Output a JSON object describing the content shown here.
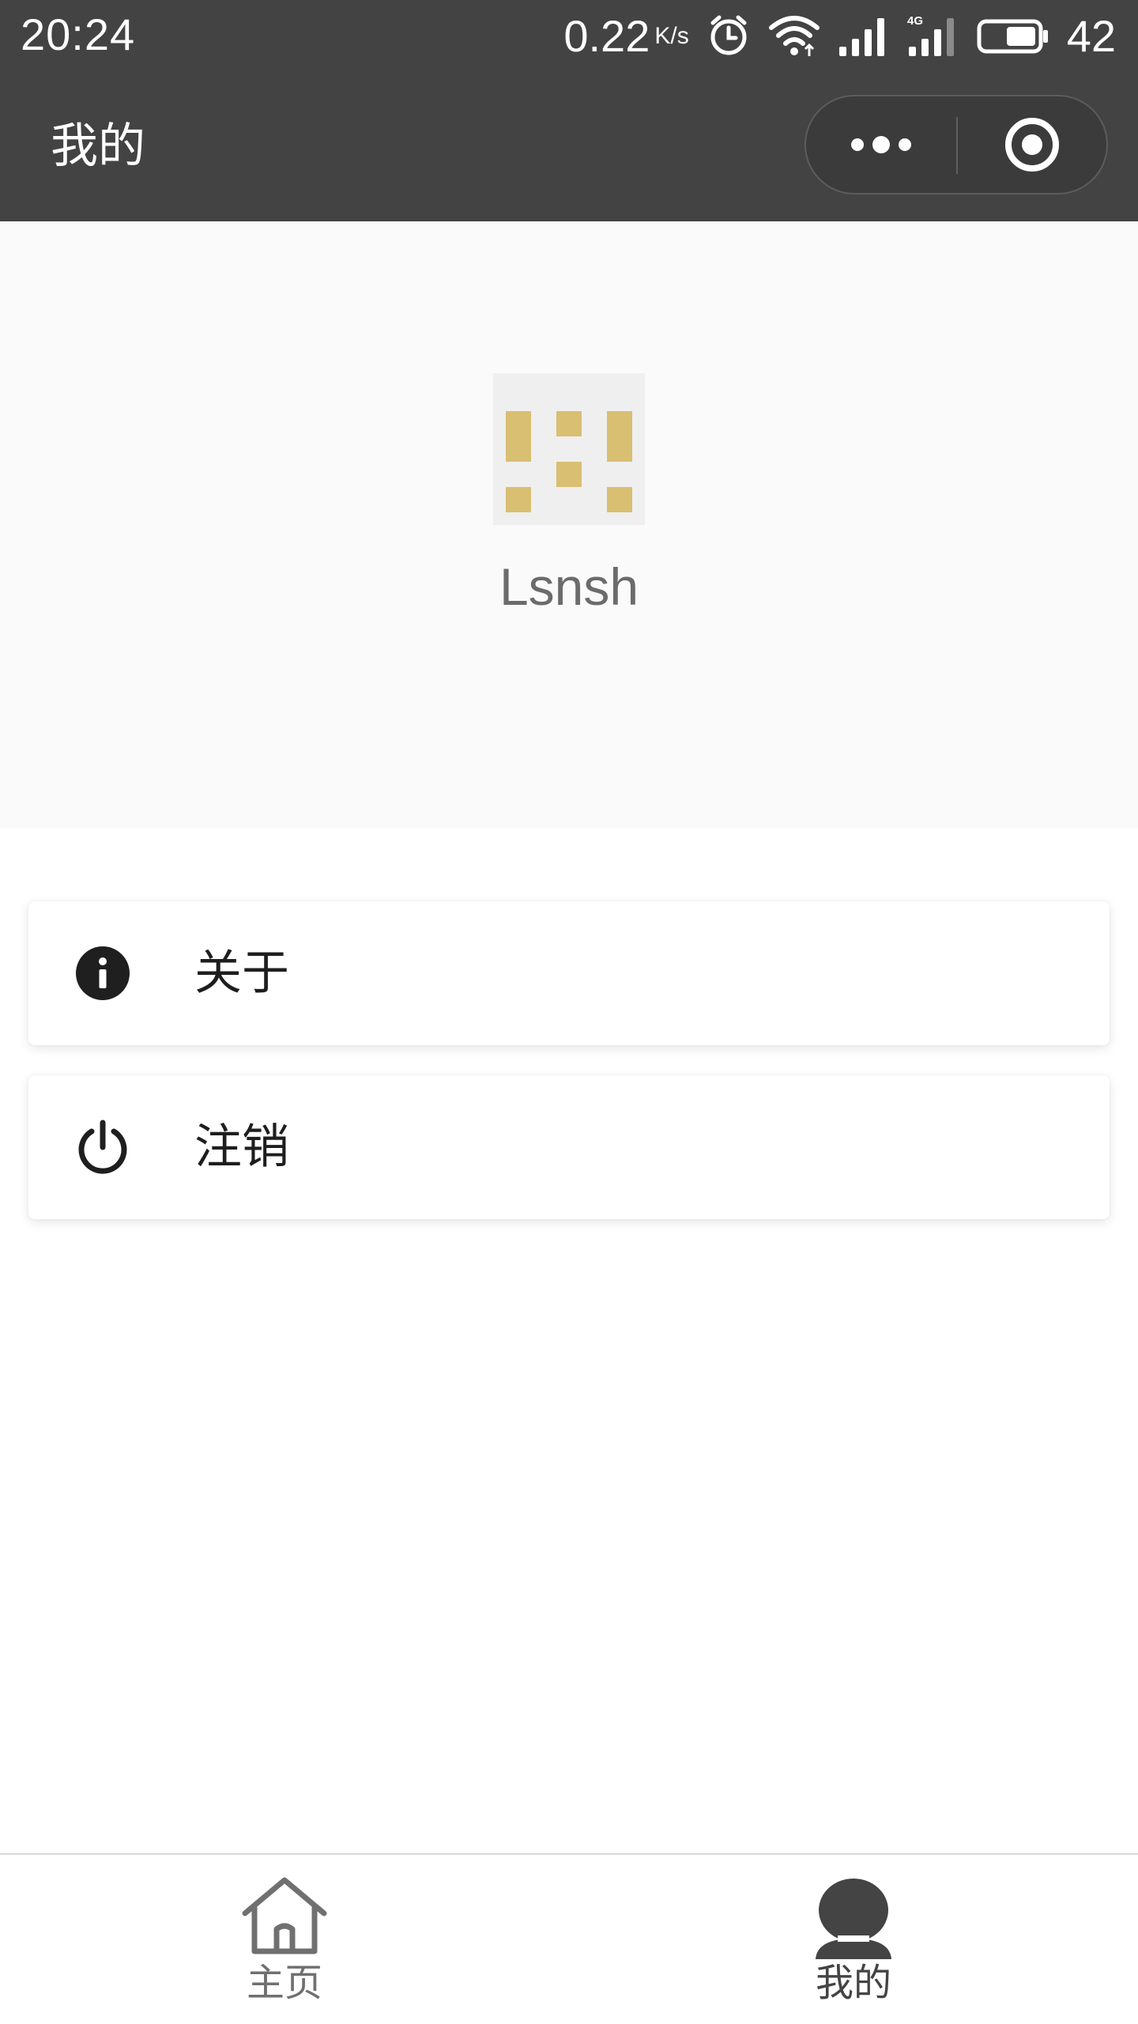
{
  "status_bar": {
    "time": "20:24",
    "net_speed": "0.22",
    "net_speed_unit": "K/s",
    "network_type": "4G",
    "battery": "42",
    "icons": [
      "alarm-icon",
      "wifi-icon",
      "signal-icon",
      "signal-4g-icon",
      "battery-icon"
    ]
  },
  "header": {
    "title": "我的",
    "capsule": {
      "more": "more-dots-icon",
      "close": "target-circle-icon"
    }
  },
  "profile": {
    "username": "Lsnsh",
    "avatar_color": "#d9bf72"
  },
  "menu": [
    {
      "label": "关于",
      "icon": "info-icon"
    },
    {
      "label": "注销",
      "icon": "power-icon"
    }
  ],
  "tabbar": {
    "tabs": [
      {
        "label": "主页",
        "icon": "home-icon",
        "active": false
      },
      {
        "label": "我的",
        "icon": "user-icon",
        "active": true
      }
    ],
    "inactive_color": "#707070",
    "active_color": "#444444"
  }
}
